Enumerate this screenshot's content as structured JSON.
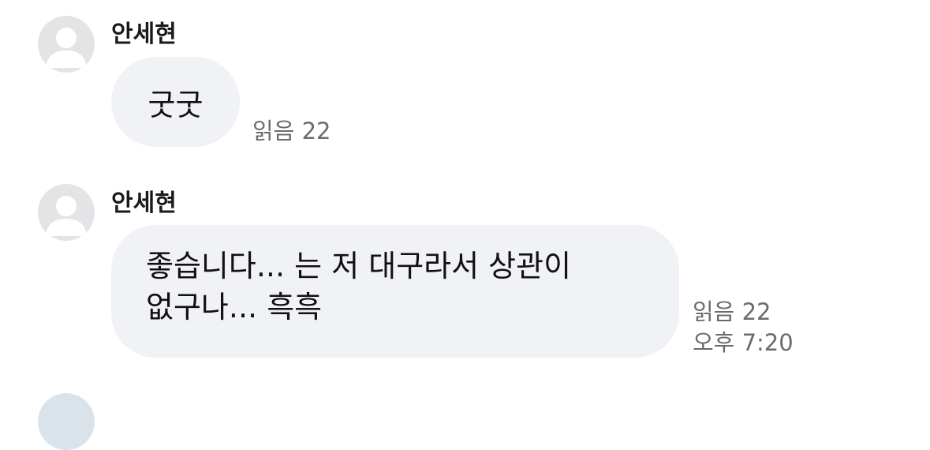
{
  "messages": [
    {
      "sender": "안세현",
      "avatar_icon": "default-user-avatar-icon",
      "text_lines": [
        "굿굿"
      ],
      "read_label": "읽음 22",
      "time": ""
    },
    {
      "sender": "안세현",
      "avatar_icon": "default-user-avatar-icon",
      "text_lines": [
        "좋습니다... 는 저 대구라서 상관이",
        "없구나... 흑흑"
      ],
      "read_label": "읽음 22",
      "time": "오후 7:20"
    }
  ],
  "colors": {
    "bubble": "#f1f2f6",
    "avatar_bg": "#e4e4e6",
    "meta_text": "#6b6b6b"
  }
}
